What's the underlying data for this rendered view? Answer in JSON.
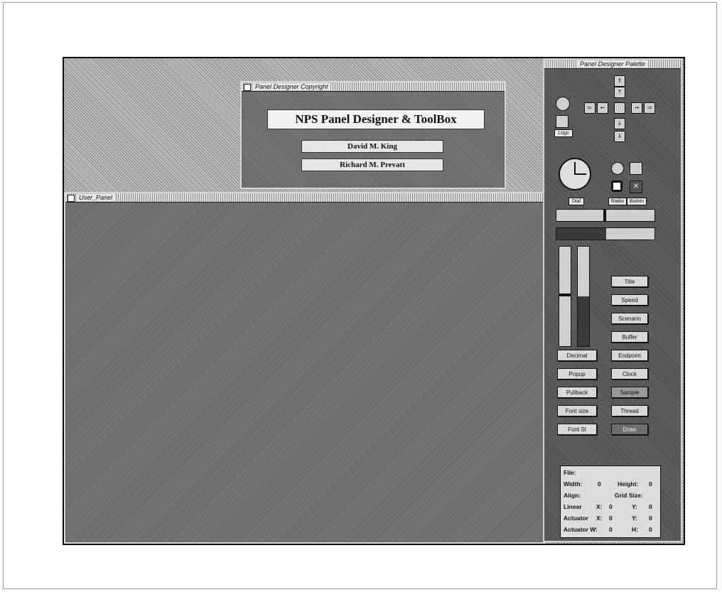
{
  "about_window": {
    "title": "Panel Designer Copyright",
    "banner": "NPS Panel Designer & ToolBox",
    "authors": [
      "David M. King",
      "Richard M. Prevatt"
    ]
  },
  "user_panel": {
    "title": "User_Panel"
  },
  "palette": {
    "title": "Panel Designer Palette",
    "logo_label": "Logo",
    "dial_label": "Dial",
    "radio_label": "Radio",
    "button_label": "Button",
    "right_buttons": [
      "Title",
      "Speed",
      "Scenario",
      "Buffer",
      "Endpoint",
      "Clock",
      "Sample",
      "Thread",
      "Draw"
    ],
    "left_buttons": [
      "Decimal",
      "Popup",
      "Pullback",
      "Font size",
      "Font St"
    ],
    "info": {
      "file": "File:",
      "width": "Width:",
      "width_val": "0",
      "height": "Height:",
      "height_val": "0",
      "align": "Align:",
      "grid": "Grid Size:",
      "linear": "Linear",
      "x": "X:",
      "y": "Y:",
      "linear_x": "0",
      "linear_y": "0",
      "act1": "Actuator",
      "act1_x": "0",
      "act1_y": "0",
      "act2": "Actuator W:",
      "act2_w": "0",
      "h": "H:",
      "act2_h": "0"
    }
  }
}
